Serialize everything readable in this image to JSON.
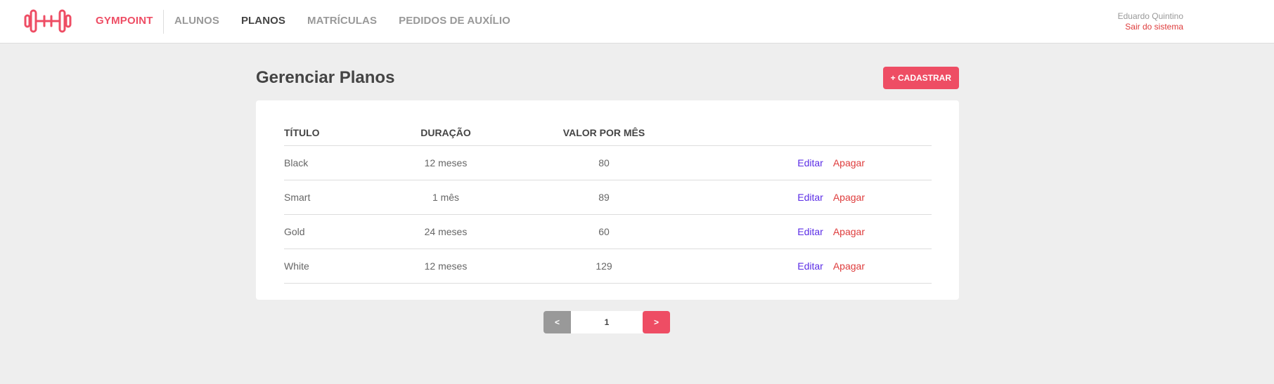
{
  "header": {
    "brand": "GYMPOINT",
    "logo_icon": "dumbbell-icon",
    "nav": [
      {
        "label": "ALUNOS",
        "active": false
      },
      {
        "label": "PLANOS",
        "active": true
      },
      {
        "label": "MATRÍCULAS",
        "active": false
      },
      {
        "label": "PEDIDOS DE AUXÍLIO",
        "active": false
      }
    ],
    "user": {
      "name": "Eduardo Quintino",
      "logout_label": "Sair do sistema"
    }
  },
  "main": {
    "title": "Gerenciar Planos",
    "add_label": "+ CADASTRAR",
    "columns": [
      "TÍTULO",
      "DURAÇÃO",
      "VALOR POR MÊS"
    ],
    "rows": [
      {
        "title": "Black",
        "duration": "12 meses",
        "price": "80",
        "edit": "Editar",
        "delete": "Apagar"
      },
      {
        "title": "Smart",
        "duration": "1 mês",
        "price": "89",
        "edit": "Editar",
        "delete": "Apagar"
      },
      {
        "title": "Gold",
        "duration": "24 meses",
        "price": "60",
        "edit": "Editar",
        "delete": "Apagar"
      },
      {
        "title": "White",
        "duration": "12 meses",
        "price": "129",
        "edit": "Editar",
        "delete": "Apagar"
      }
    ]
  },
  "pagination": {
    "prev_label": "<",
    "page": "1",
    "next_label": ">"
  },
  "colors": {
    "brand": "#ee4d64",
    "background": "#eeeeee",
    "edit": "#5b2de6",
    "delete": "#de3b3b",
    "pager_prev": "#999999"
  }
}
